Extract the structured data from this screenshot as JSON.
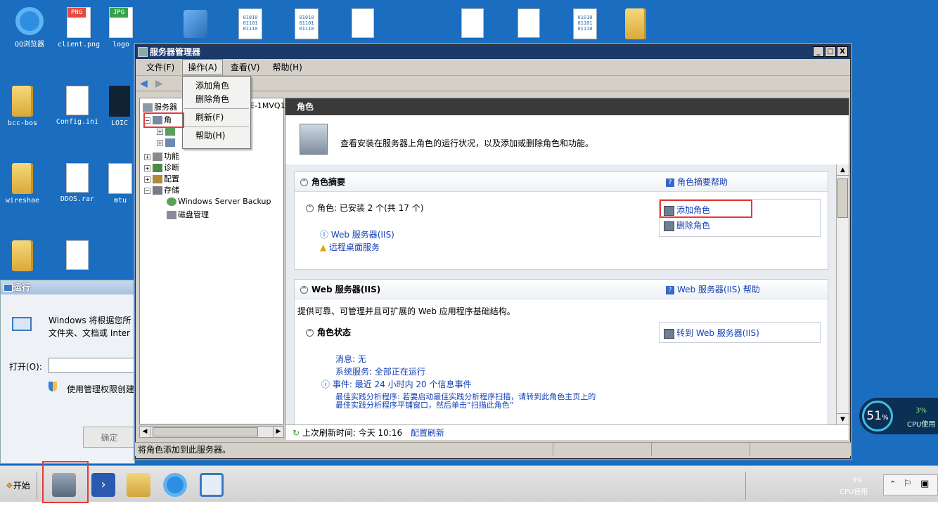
{
  "desktop": {
    "icons": [
      {
        "label": "QQ浏览器",
        "kind": "qq"
      },
      {
        "label": "client.png",
        "kind": "png",
        "tag": "PNG"
      },
      {
        "label": "logo",
        "kind": "jpg",
        "tag": "JPG"
      },
      {
        "label": "bcc-bos",
        "kind": "folder"
      },
      {
        "label": "Config.ini",
        "kind": "ini"
      },
      {
        "label": "LOIC",
        "kind": "app"
      },
      {
        "label": "wireshae",
        "kind": "folder"
      },
      {
        "label": "DDOS.rar",
        "kind": "rar"
      },
      {
        "label": "mtu",
        "kind": "bin"
      }
    ],
    "bin_text": "01010\n01101\n01110"
  },
  "window": {
    "title": "服务器管理器",
    "controls": [
      "_",
      "□",
      "X"
    ],
    "menu": [
      {
        "label": "文件(F)"
      },
      {
        "label": "操作(A)"
      },
      {
        "label": "查看(V)"
      },
      {
        "label": "帮助(H)"
      }
    ],
    "action_menu": {
      "items": [
        "添加角色",
        "删除角色",
        "刷新(F)",
        "帮助(H)"
      ]
    },
    "tree": {
      "root": "服务器",
      "root_suffix": "E-1MVQ1",
      "selected": "角",
      "items": [
        "功能",
        "诊断",
        "配置",
        "存储",
        "Windows Server Backup",
        "磁盘管理"
      ]
    },
    "status_text": "将角色添加到此服务器。"
  },
  "pane": {
    "header": "角色",
    "description": "查看安装在服务器上角色的运行状况，以及添加或删除角色和功能。",
    "summary": {
      "title": "角色摘要",
      "help": "角色摘要帮助",
      "roles_line": "角色: 已安装 2 个(共 17 个)",
      "roles": [
        "Web 服务器(IIS)",
        "远程桌面服务"
      ],
      "actions": [
        "添加角色",
        "删除角色"
      ]
    },
    "web": {
      "title": "Web 服务器(IIS)",
      "help": "Web 服务器(IIS) 帮助",
      "desc": "提供可靠、可管理并且可扩展的 Web 应用程序基础结构。",
      "status_title": "角色状态",
      "goto": "转到 Web 服务器(IIS)",
      "lines": [
        "消息: 无",
        "系统服务: 全部正在运行",
        "事件: 最近 24 小时内 20 个信息事件"
      ],
      "bpa1": "最佳实践分析程序: 若要启动最佳实践分析程序扫描，请转到此角色主页上的",
      "bpa2": "最佳实践分析程序平铺窗口，然后单击“扫描此角色”"
    },
    "refresh": {
      "text": "上次刷新时间: 今天 10:16",
      "link": "配置刷新"
    }
  },
  "run_dialog": {
    "title": "运行",
    "line1": "Windows 将根据您所",
    "line2": "文件夹、文档或 Inter",
    "open_label": "打开(O):",
    "admin": "使用管理权限创建",
    "ok": "确定"
  },
  "taskbar": {
    "start": "开始",
    "cpu": {
      "pct": "3%",
      "label": "CPU使用"
    }
  },
  "cpu_widget": {
    "percent": "51",
    "unit": "%",
    "small_pct": "3%",
    "label": "CPU使用"
  }
}
